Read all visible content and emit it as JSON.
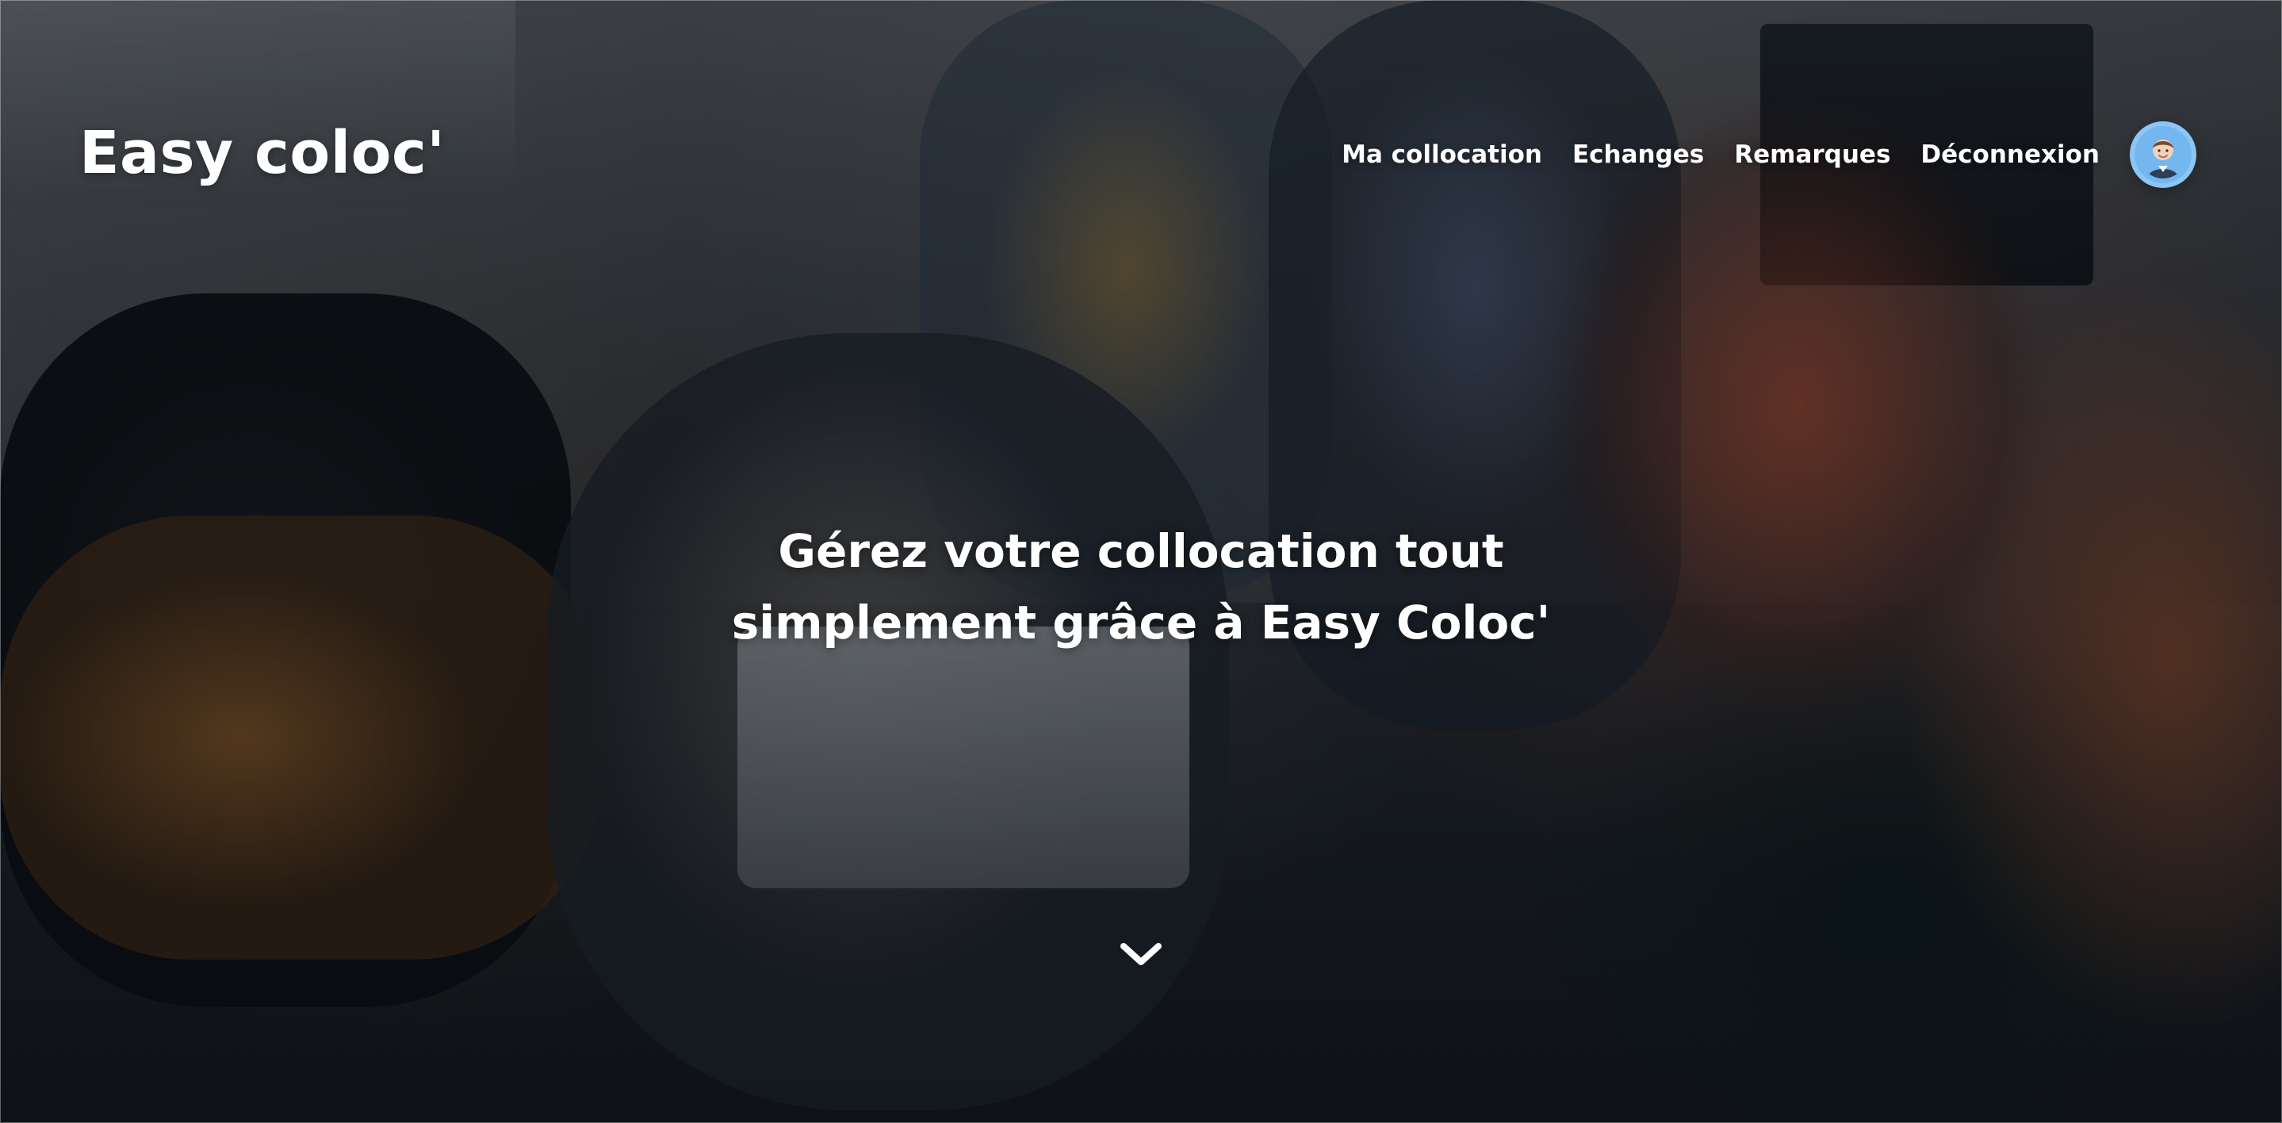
{
  "brand": {
    "title": "Easy coloc'"
  },
  "nav": {
    "items": [
      {
        "label": "Ma collocation"
      },
      {
        "label": "Echanges"
      },
      {
        "label": "Remarques"
      },
      {
        "label": "Déconnexion"
      }
    ],
    "avatar_icon": "user-avatar-icon"
  },
  "hero": {
    "title_line_1": "Gérez votre collocation tout",
    "title_line_2": "simplement grâce à Easy Coloc'",
    "scroll_icon": "chevron-down-icon"
  },
  "colors": {
    "text": "#ffffff",
    "avatar_bg": "#74b7ef",
    "avatar_border": "#8cc6f6"
  }
}
